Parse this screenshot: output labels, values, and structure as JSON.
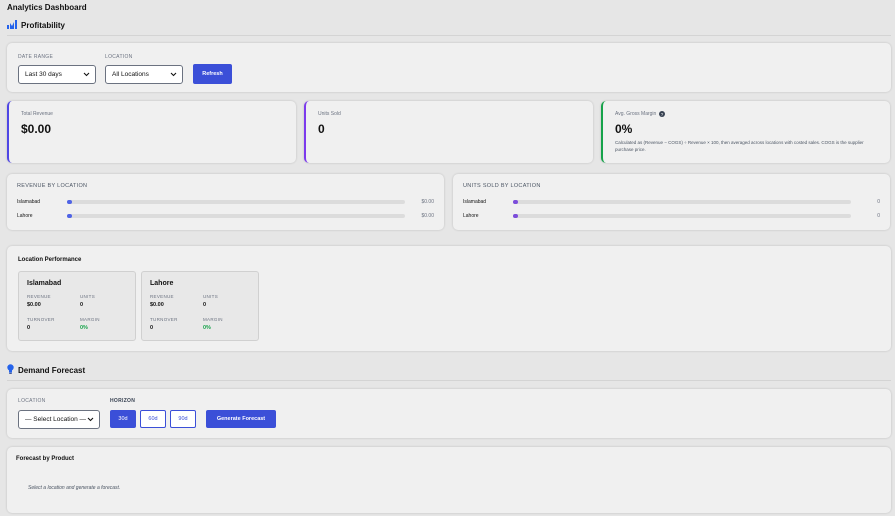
{
  "app_title": "Analytics Dashboard",
  "profitability": {
    "title": "Profitability"
  },
  "filters": {
    "date_range_label": "DATE RANGE",
    "date_range_value": "Last 30 days",
    "location_label": "LOCATION",
    "location_value": "All Locations",
    "refresh_label": "Refresh"
  },
  "kpis": {
    "revenue": {
      "label": "Total Revenue",
      "value": "$0.00",
      "accent": "#4f46e5"
    },
    "units": {
      "label": "Units Sold",
      "value": "0",
      "accent": "#7c3aed"
    },
    "margin": {
      "label": "Avg. Gross Margin",
      "value": "0%",
      "accent": "#16a34a",
      "note": "Calculated as (Revenue − COGS) ÷ Revenue × 100, then averaged across locations with costed sales. COGS is the supplier purchase price."
    }
  },
  "revenue_by_location": {
    "title": "REVENUE BY LOCATION",
    "fill_color": "#4f63e6",
    "rows": [
      {
        "name": "Islamabad",
        "value": "$0.00",
        "fraction": 0
      },
      {
        "name": "Lahore",
        "value": "$0.00",
        "fraction": 0
      }
    ]
  },
  "units_by_location": {
    "title": "UNITS SOLD BY LOCATION",
    "fill_color": "#7c4ddb",
    "rows": [
      {
        "name": "Islamabad",
        "value": "0",
        "fraction": 0
      },
      {
        "name": "Lahore",
        "value": "0",
        "fraction": 0
      }
    ]
  },
  "location_performance": {
    "title": "Location Performance",
    "cards": [
      {
        "name": "Islamabad",
        "revenue_label": "REVENUE",
        "revenue": "$0.00",
        "units_label": "UNITS",
        "units": "0",
        "turnover_label": "TURNOVER",
        "turnover": "0",
        "margin_label": "MARGIN",
        "margin": "0%"
      },
      {
        "name": "Lahore",
        "revenue_label": "REVENUE",
        "revenue": "$0.00",
        "units_label": "UNITS",
        "units": "0",
        "turnover_label": "TURNOVER",
        "turnover": "0",
        "margin_label": "MARGIN",
        "margin": "0%"
      }
    ]
  },
  "demand_forecast": {
    "title": "Demand Forecast",
    "location_label": "LOCATION",
    "location_value": "— Select Location —",
    "horizon_label": "HORIZON",
    "horizons": [
      "30d",
      "60d",
      "90d"
    ],
    "selected_horizon": "30d",
    "generate_label": "Generate Forecast"
  },
  "forecast_by_product": {
    "title": "Forecast by Product",
    "empty_message": "Select a location and generate a forecast."
  },
  "colors": {
    "primary": "#3b4fd8",
    "icon_blue": "#2563eb"
  },
  "icons": {
    "profitability": "bar-chart-icon",
    "forecast": "lightbulb-icon",
    "help": "help-circle-icon",
    "chevron": "chevron-down-icon"
  }
}
